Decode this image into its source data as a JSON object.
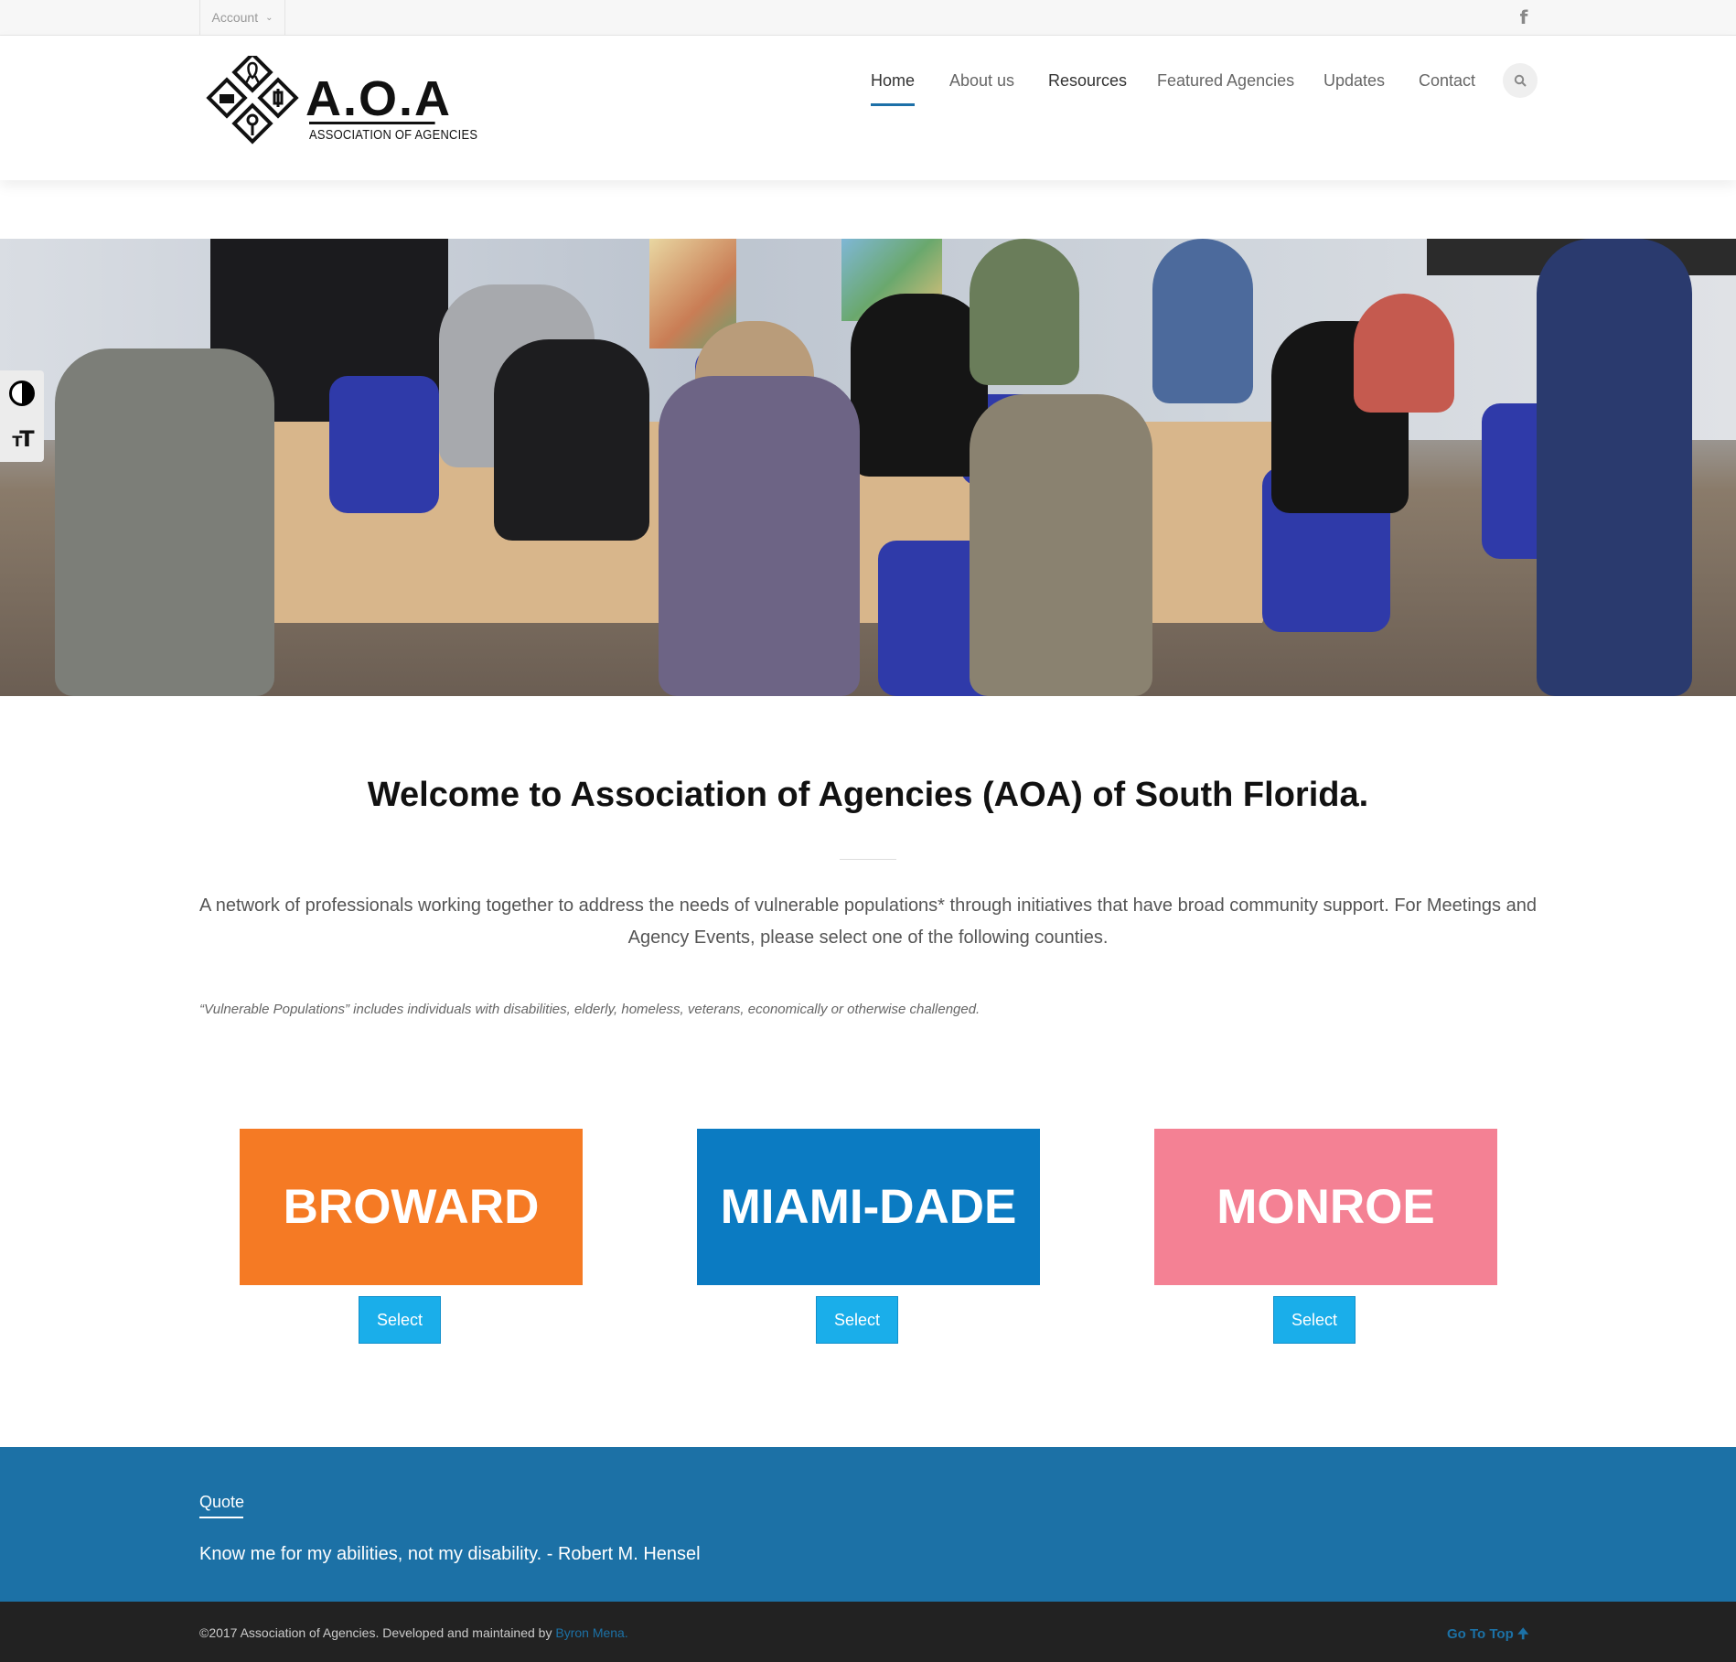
{
  "topbar": {
    "account_label": "Account",
    "social_icon": "facebook-icon"
  },
  "logo": {
    "title": "A.O.A",
    "subtitle": "ASSOCIATION OF AGENCIES"
  },
  "nav": {
    "items": [
      {
        "label": "Home",
        "active": true
      },
      {
        "label": "About us"
      },
      {
        "label": "Resources"
      },
      {
        "label": "Featured Agencies"
      },
      {
        "label": "Updates"
      },
      {
        "label": "Contact"
      }
    ],
    "search_icon": "search-icon"
  },
  "accessibility": {
    "contrast_icon": "contrast-icon",
    "fontsize_icon": "font-size-icon"
  },
  "hero": {
    "image": "meeting-photo"
  },
  "welcome": {
    "title": "Welcome to Association of Agencies (AOA) of South Florida.",
    "intro": "A network of professionals working together to address the needs of vulnerable populations* through initiatives that have broad community support. For Meetings and Agency Events, please select one of the following counties.",
    "footnote": "“Vulnerable Populations” includes individuals with disabilities, elderly, homeless, veterans, economically or otherwise challenged."
  },
  "counties": [
    {
      "name": "BROWARD",
      "color": "#f57a24",
      "button": "Select"
    },
    {
      "name": "MIAMI-DADE",
      "color": "#0b7bc2",
      "button": "Select"
    },
    {
      "name": "MONROE",
      "color": "#f48194",
      "button": "Select"
    }
  ],
  "quote": {
    "title": "Quote",
    "text": "Know me for my abilities, not my disability. - Robert M. Hensel",
    "color": "#1c71a6"
  },
  "footer": {
    "copyright": "©2017 Association of Agencies. Developed and maintained by ",
    "developer": "Byron Mena.",
    "go_to_top": "Go To Top"
  }
}
